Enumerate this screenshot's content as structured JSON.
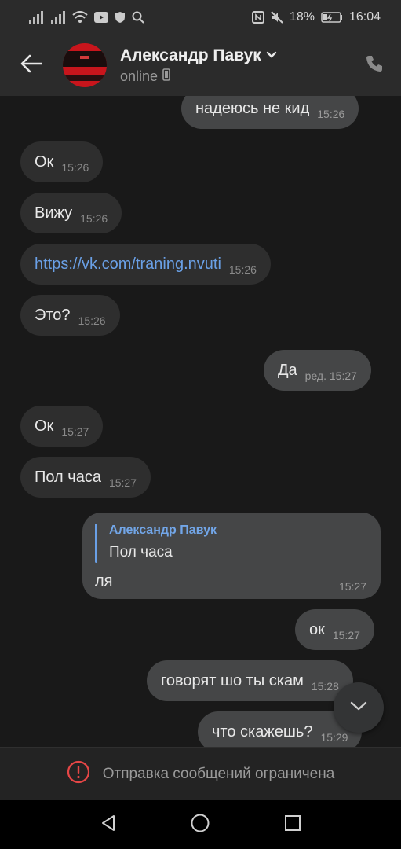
{
  "status_bar": {
    "battery": "18%",
    "time": "16:04"
  },
  "header": {
    "contact_name": "Александр Павук",
    "presence": "online"
  },
  "messages": [
    {
      "dir": "out",
      "text": "надеюсь не кид",
      "time": "15:26"
    },
    {
      "dir": "in",
      "text": "Ок",
      "time": "15:26"
    },
    {
      "dir": "in",
      "text": "Вижу",
      "time": "15:26"
    },
    {
      "dir": "in",
      "text": "https://vk.com/traning.nvuti",
      "time": "15:26",
      "is_link": true
    },
    {
      "dir": "in",
      "text": "Это?",
      "time": "15:26"
    },
    {
      "dir": "out",
      "text": "Да",
      "time": "ред. 15:27"
    },
    {
      "dir": "in",
      "text": "Ок",
      "time": "15:27"
    },
    {
      "dir": "in",
      "text": "Пол часа",
      "time": "15:27"
    },
    {
      "dir": "out",
      "text": "ля",
      "time": "15:27",
      "reply": {
        "author": "Александр Павук",
        "text": "Пол часа"
      }
    },
    {
      "dir": "out",
      "text": "ок",
      "time": "15:27"
    },
    {
      "dir": "out",
      "text": "говорят шо ты скам",
      "time": "15:28"
    },
    {
      "dir": "out",
      "text": "что скажешь?",
      "time": "15:29"
    }
  ],
  "footer": {
    "restricted_text": "Отправка сообщений ограничена"
  },
  "colors": {
    "accent": "#6aa0e6",
    "bubble_in": "#2e2e2e",
    "bubble_out": "#454647",
    "warning": "#e64646"
  },
  "icons": [
    "signal-icon",
    "wifi-icon",
    "youtube-icon",
    "shield-icon",
    "search-icon",
    "nfc-icon",
    "mute-icon",
    "battery-icon",
    "back-arrow-icon",
    "chevron-down-icon",
    "phone-device-icon",
    "phone-call-icon",
    "chevron-down-icon",
    "warning-icon",
    "nav-back-icon",
    "nav-home-icon",
    "nav-recents-icon"
  ]
}
